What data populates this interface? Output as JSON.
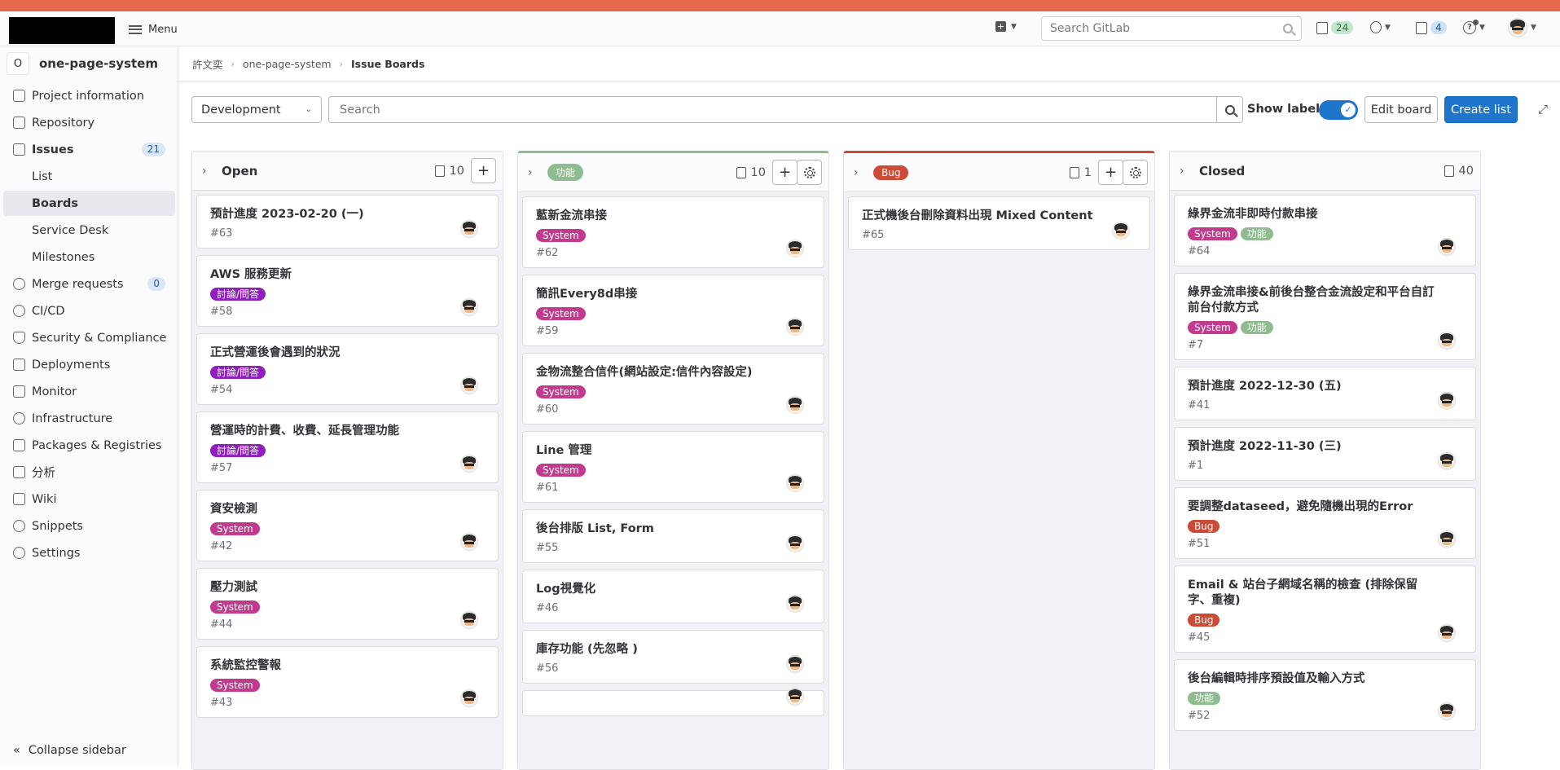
{
  "nav": {
    "menu_label": "Menu",
    "search_placeholder": "Search GitLab",
    "issues_count": "24",
    "todos_count": "4",
    "help_label": "?"
  },
  "sidebar": {
    "project_initial": "O",
    "project_name": "one-page-system",
    "items": [
      {
        "label": "Project information"
      },
      {
        "label": "Repository"
      },
      {
        "label": "Issues",
        "count": "21"
      },
      {
        "label": "List"
      },
      {
        "label": "Boards"
      },
      {
        "label": "Service Desk"
      },
      {
        "label": "Milestones"
      },
      {
        "label": "Merge requests",
        "count": "0"
      },
      {
        "label": "CI/CD"
      },
      {
        "label": "Security & Compliance"
      },
      {
        "label": "Deployments"
      },
      {
        "label": "Monitor"
      },
      {
        "label": "Infrastructure"
      },
      {
        "label": "Packages & Registries"
      },
      {
        "label": "分析"
      },
      {
        "label": "Wiki"
      },
      {
        "label": "Snippets"
      },
      {
        "label": "Settings"
      }
    ],
    "collapse_label": "Collapse sidebar"
  },
  "breadcrumb": {
    "owner": "許文奕",
    "project": "one-page-system",
    "current": "Issue Boards"
  },
  "filter": {
    "board_name": "Development",
    "search_placeholder": "Search",
    "show_labels": "Show labels",
    "edit_board": "Edit board",
    "create_list": "Create list"
  },
  "colors": {
    "system": "#c23a8e",
    "discuss": "#8f1ebf",
    "feature": "#8fbc8f",
    "bug": "#cc4b37"
  },
  "lists": [
    {
      "title": "Open",
      "count": "10",
      "cards": [
        {
          "title": "預計進度 2023-02-20 (一)",
          "labels": [],
          "num": "#63"
        },
        {
          "title": "AWS 服務更新",
          "labels": [
            {
              "text": "討論/問答",
              "color": "#8f1ebf"
            }
          ],
          "num": "#58"
        },
        {
          "title": "正式營運後會遇到的狀況",
          "labels": [
            {
              "text": "討論/問答",
              "color": "#8f1ebf"
            }
          ],
          "num": "#54"
        },
        {
          "title": "營運時的計費、收費、延長管理功能",
          "labels": [
            {
              "text": "討論/問答",
              "color": "#8f1ebf"
            }
          ],
          "num": "#57"
        },
        {
          "title": "資安檢測",
          "labels": [
            {
              "text": "System",
              "color": "#c23a8e"
            }
          ],
          "num": "#42"
        },
        {
          "title": "壓力測試",
          "labels": [
            {
              "text": "System",
              "color": "#c23a8e"
            }
          ],
          "num": "#44"
        },
        {
          "title": "系統監控警報",
          "labels": [
            {
              "text": "System",
              "color": "#c23a8e"
            }
          ],
          "num": "#43"
        }
      ]
    },
    {
      "title": "功能",
      "is_label": true,
      "label_color": "#8fbc8f",
      "count": "10",
      "cards": [
        {
          "title": "藍新金流串接",
          "labels": [
            {
              "text": "System",
              "color": "#c23a8e"
            }
          ],
          "num": "#62"
        },
        {
          "title": "簡訊Every8d串接",
          "labels": [
            {
              "text": "System",
              "color": "#c23a8e"
            }
          ],
          "num": "#59"
        },
        {
          "title": "金物流整合信件(網站設定:信件內容設定)",
          "labels": [
            {
              "text": "System",
              "color": "#c23a8e"
            }
          ],
          "num": "#60"
        },
        {
          "title": "Line 管理",
          "labels": [
            {
              "text": "System",
              "color": "#c23a8e"
            }
          ],
          "num": "#61"
        },
        {
          "title": "後台排版 List, Form",
          "labels": [],
          "num": "#55"
        },
        {
          "title": "Log視覺化",
          "labels": [],
          "num": "#46"
        },
        {
          "title": "庫存功能 (先忽略 )",
          "labels": [],
          "num": "#56"
        },
        {
          "title": "",
          "labels": [],
          "num": ""
        }
      ]
    },
    {
      "title": "Bug",
      "is_label": true,
      "label_color": "#cc4b37",
      "count": "1",
      "cards": [
        {
          "title": "正式機後台刪除資料出現 Mixed Content",
          "labels": [],
          "num": "#65"
        }
      ]
    },
    {
      "title": "Closed",
      "count": "40",
      "cards": [
        {
          "title": "綠界金流非即時付款串接",
          "labels": [
            {
              "text": "System",
              "color": "#c23a8e"
            },
            {
              "text": "功能",
              "color": "#8fbc8f"
            }
          ],
          "num": "#64"
        },
        {
          "title": "綠界金流串接&前後台整合金流設定和平台自訂前台付款方式",
          "labels": [
            {
              "text": "System",
              "color": "#c23a8e"
            },
            {
              "text": "功能",
              "color": "#8fbc8f"
            }
          ],
          "num": "#7"
        },
        {
          "title": "預計進度 2022-12-30 (五)",
          "labels": [],
          "num": "#41"
        },
        {
          "title": "預計進度 2022-11-30 (三)",
          "labels": [],
          "num": "#1"
        },
        {
          "title": "要調整dataseed，避免隨機出現的Error",
          "labels": [
            {
              "text": "Bug",
              "color": "#cc4b37"
            }
          ],
          "num": "#51"
        },
        {
          "title": "Email & 站台子網域名稱的檢查 (排除保留字、重複)",
          "labels": [
            {
              "text": "Bug",
              "color": "#cc4b37"
            }
          ],
          "num": "#45"
        },
        {
          "title": "後台編輯時排序預設值及輸入方式",
          "labels": [
            {
              "text": "功能",
              "color": "#8fbc8f"
            }
          ],
          "num": "#52"
        }
      ]
    }
  ]
}
